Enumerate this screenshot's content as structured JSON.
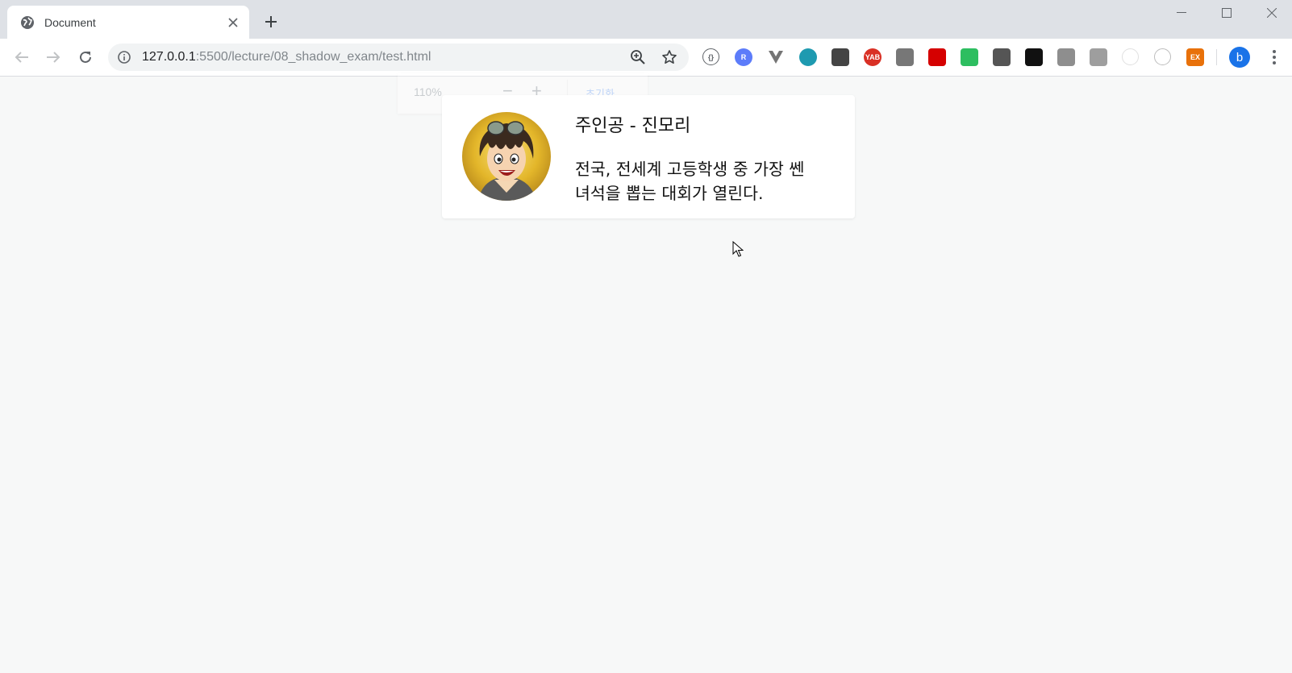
{
  "browser": {
    "tab": {
      "title": "Document",
      "favicon": "globe-icon"
    },
    "new_tab_icon": "plus-icon",
    "window_controls": [
      "minimize-icon",
      "maximize-icon",
      "close-icon"
    ],
    "toolbar": {
      "back_icon": "arrow-left-icon",
      "forward_icon": "arrow-right-icon",
      "reload_icon": "reload-icon",
      "url_host": "127.0.0.1",
      "url_rest": ":5500/lecture/08_shadow_exam/test.html",
      "site_info_icon": "info-icon",
      "zoom_icon": "zoom-icon",
      "bookmark_icon": "star-icon",
      "profile_initial": "b"
    },
    "extensions": [
      {
        "name": "braces-ext-icon",
        "color": "#5f6368",
        "label": "{}"
      },
      {
        "name": "r-ext-icon",
        "color": "#5c7cfa",
        "label": "R"
      },
      {
        "name": "vue-ext-icon",
        "color": "#757575",
        "label": ""
      },
      {
        "name": "teal-circle-ext-icon",
        "color": "#1e9ab0",
        "label": ""
      },
      {
        "name": "monitor-ext-icon",
        "color": "#444444",
        "label": ""
      },
      {
        "name": "yab-ext-icon",
        "color": "#d93025",
        "label": "YAB"
      },
      {
        "name": "film-ext-icon",
        "color": "#777777",
        "label": ""
      },
      {
        "name": "stop-hand-ext-icon",
        "color": "#d50000",
        "label": ""
      },
      {
        "name": "evernote-ext-icon",
        "color": "#2dbe60",
        "label": ""
      },
      {
        "name": "eyedropper-ext-icon",
        "color": "#555555",
        "label": ""
      },
      {
        "name": "glasses-ext-icon",
        "color": "#111111",
        "label": ""
      },
      {
        "name": "rainbow-ext-icon",
        "color": "#8e8e8e",
        "label": ""
      },
      {
        "name": "box-ext-icon",
        "color": "#9e9e9e",
        "label": ""
      },
      {
        "name": "faded-ext-icon",
        "color": "#e0e0e0",
        "label": ""
      },
      {
        "name": "target-ext-icon",
        "color": "#bdbdbd",
        "label": ""
      },
      {
        "name": "ex-ext-icon",
        "color": "#e8710a",
        "label": "EX"
      }
    ]
  },
  "zoom_bubble": {
    "level": "110%",
    "minus": "−",
    "plus": "+",
    "reset_label": "초기화"
  },
  "card": {
    "title": "주인공 - 진모리",
    "description": "전국, 전세계 고등학생 중 가장 쎈 녀석을 뽑는 대회가 열린다."
  }
}
